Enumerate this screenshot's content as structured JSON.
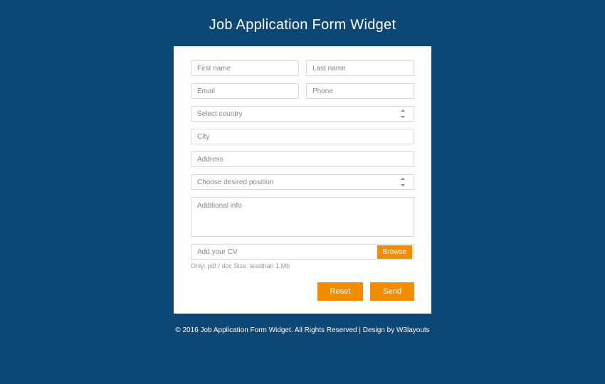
{
  "title": "Job Application Form Widget",
  "form": {
    "first_name": {
      "placeholder": "First name"
    },
    "last_name": {
      "placeholder": "Last name"
    },
    "email": {
      "placeholder": "Email"
    },
    "phone": {
      "placeholder": "Phone"
    },
    "country_select": {
      "placeholder": "Select country"
    },
    "city": {
      "placeholder": "City"
    },
    "address": {
      "placeholder": "Address"
    },
    "position_select": {
      "placeholder": "Choose desired position"
    },
    "additional_info": {
      "placeholder": "Additional info"
    },
    "cv": {
      "placeholder": "Add your CV",
      "browse_label": "Browse"
    },
    "hint": "Only: pdf / doc Size: lessthan 1 Mb",
    "reset_label": "Reset",
    "send_label": "Send"
  },
  "footer": {
    "copyright": "© 2016 Job Application Form Widget. All Rights Reserved | Design by ",
    "link_label": "W3layouts"
  },
  "colors": {
    "background": "#0c4776",
    "accent": "#f28c00",
    "card": "#ffffff",
    "border": "#d9d9d9",
    "muted": "#888888"
  }
}
